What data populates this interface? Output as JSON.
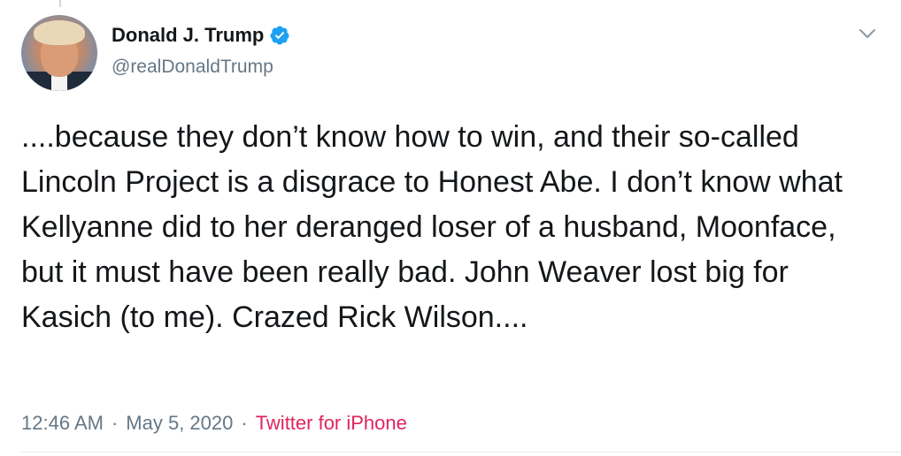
{
  "author": {
    "display_name": "Donald J. Trump",
    "handle": "@realDonaldTrump",
    "verified": true,
    "verified_color": "#1da1f2"
  },
  "tweet": {
    "text": "....because they don’t know how to win, and their so-called Lincoln Project is a disgrace to Honest Abe. I don’t know what Kellyanne did to her deranged loser of a husband, Moonface, but it must have been really bad. John Weaver lost big for Kasich (to me). Crazed Rick Wilson....",
    "time": "12:46 AM",
    "date": "May 5, 2020",
    "separator": "·",
    "source": "Twitter for iPhone",
    "source_color": "#e0245e"
  },
  "icons": {
    "verified": "verified-badge-icon",
    "menu": "chevron-down-icon"
  }
}
